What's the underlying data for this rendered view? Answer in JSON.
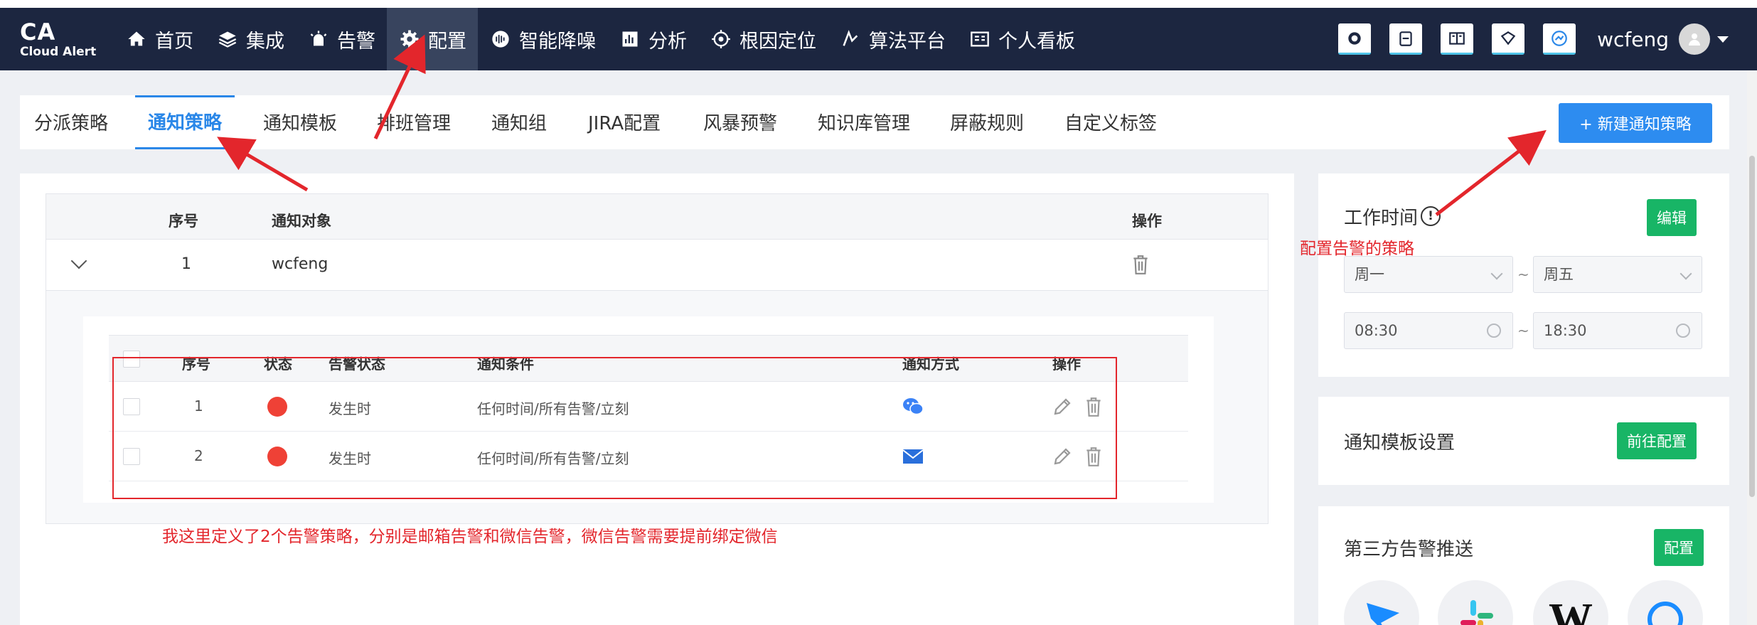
{
  "brand": {
    "main": "CA",
    "sub": "Cloud Alert"
  },
  "nav": [
    {
      "label": "首页",
      "icon": "home-icon"
    },
    {
      "label": "集成",
      "icon": "layers-icon"
    },
    {
      "label": "告警",
      "icon": "alarm-icon"
    },
    {
      "label": "配置",
      "icon": "gear-icon",
      "active": true
    },
    {
      "label": "智能降噪",
      "icon": "noise-icon"
    },
    {
      "label": "分析",
      "icon": "chart-icon"
    },
    {
      "label": "根因定位",
      "icon": "target-icon"
    },
    {
      "label": "算法平台",
      "icon": "algorithm-icon"
    },
    {
      "label": "个人看板",
      "icon": "dashboard-icon"
    }
  ],
  "user": {
    "name": "wcfeng"
  },
  "tabs": [
    {
      "label": "分派策略"
    },
    {
      "label": "通知策略",
      "active": true
    },
    {
      "label": "通知模板"
    },
    {
      "label": "排班管理"
    },
    {
      "label": "通知组"
    },
    {
      "label": "JIRA配置"
    },
    {
      "label": "风暴预警"
    },
    {
      "label": "知识库管理"
    },
    {
      "label": "屏蔽规则"
    },
    {
      "label": "自定义标签"
    }
  ],
  "new_button": "+ 新建通知策略",
  "outer_table": {
    "headers": {
      "index": "序号",
      "target": "通知对象",
      "action": "操作"
    },
    "row": {
      "index": "1",
      "target": "wcfeng"
    }
  },
  "inner_table": {
    "headers": {
      "index": "序号",
      "status": "状态",
      "alert_status": "告警状态",
      "condition": "通知条件",
      "method": "通知方式",
      "action": "操作"
    },
    "rows": [
      {
        "index": "1",
        "alert_status": "发生时",
        "condition": "任何时间/所有告警/立刻",
        "method": "wechat-icon"
      },
      {
        "index": "2",
        "alert_status": "发生时",
        "condition": "任何时间/所有告警/立刻",
        "method": "email-icon"
      }
    ]
  },
  "work_time": {
    "title": "工作时间",
    "edit": "编辑",
    "day_start": "周一",
    "day_end": "周五",
    "time_start": "08:30",
    "time_end": "18:30",
    "sep": "~"
  },
  "template_setting": {
    "title": "通知模板设置",
    "button": "前往配置"
  },
  "third_party": {
    "title": "第三方告警推送",
    "button": "配置"
  },
  "annotations": {
    "policy_note": "配置告警的策略",
    "bottom_note": "我这里定义了2个告警策略，分别是邮箱告警和微信告警，微信告警需要提前绑定微信"
  },
  "colors": {
    "nav_bg": "#1c2640",
    "accent": "#2a87e8",
    "green": "#18b566",
    "red": "#e3262c"
  }
}
